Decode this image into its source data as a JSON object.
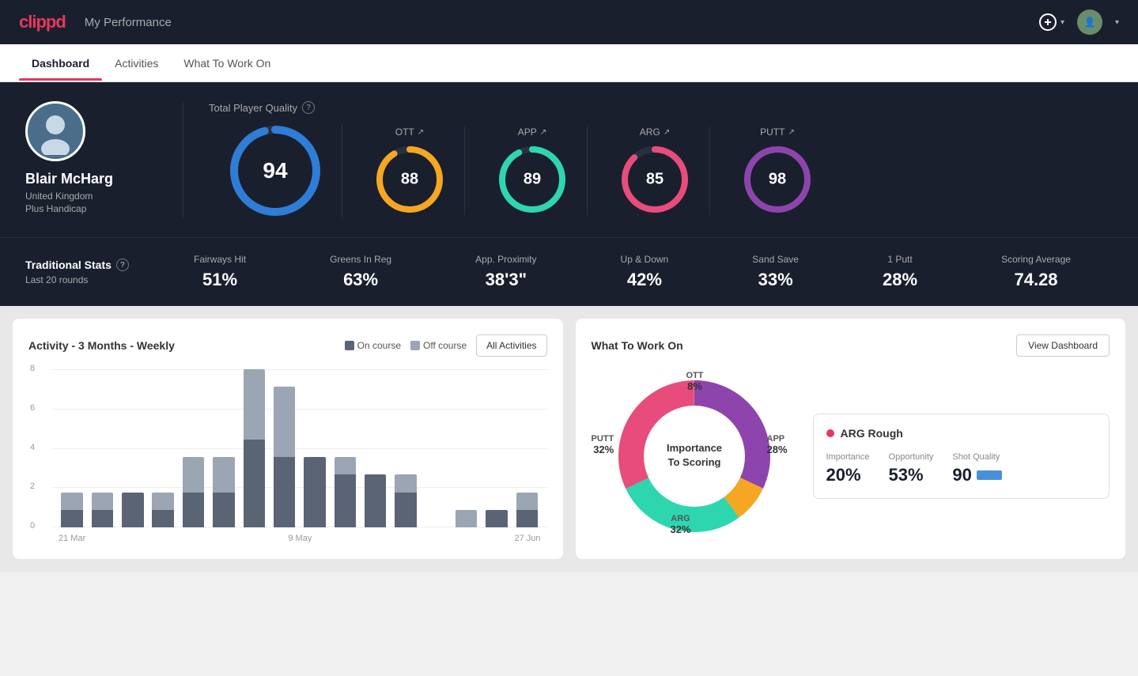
{
  "app": {
    "logo": "clippd",
    "header_title": "My Performance"
  },
  "tabs": [
    {
      "label": "Dashboard",
      "active": true
    },
    {
      "label": "Activities",
      "active": false
    },
    {
      "label": "What To Work On",
      "active": false
    }
  ],
  "profile": {
    "name": "Blair McHarg",
    "country": "United Kingdom",
    "handicap": "Plus Handicap",
    "avatar_emoji": "🧍"
  },
  "scores": {
    "title": "Total Player Quality",
    "main": {
      "value": "94",
      "color": "#2e7dd6"
    },
    "items": [
      {
        "label": "OTT",
        "value": "88",
        "color": "#f5a623"
      },
      {
        "label": "APP",
        "value": "89",
        "color": "#2ed6b0"
      },
      {
        "label": "ARG",
        "value": "85",
        "color": "#e84c7a"
      },
      {
        "label": "PUTT",
        "value": "98",
        "color": "#8e44ad"
      }
    ]
  },
  "trad_stats": {
    "title": "Traditional Stats",
    "subtitle": "Last 20 rounds",
    "items": [
      {
        "label": "Fairways Hit",
        "value": "51%"
      },
      {
        "label": "Greens In Reg",
        "value": "63%"
      },
      {
        "label": "App. Proximity",
        "value": "38'3\""
      },
      {
        "label": "Up & Down",
        "value": "42%"
      },
      {
        "label": "Sand Save",
        "value": "33%"
      },
      {
        "label": "1 Putt",
        "value": "28%"
      },
      {
        "label": "Scoring Average",
        "value": "74.28"
      }
    ]
  },
  "activity": {
    "title": "Activity - 3 Months - Weekly",
    "legend_on": "On course",
    "legend_off": "Off course",
    "all_btn": "All Activities",
    "y_labels": [
      "8",
      "6",
      "4",
      "2",
      "0"
    ],
    "x_labels": [
      "21 Mar",
      "9 May",
      "27 Jun"
    ],
    "bars": [
      {
        "on": 1,
        "off": 1
      },
      {
        "on": 1,
        "off": 1
      },
      {
        "on": 2,
        "off": 0
      },
      {
        "on": 1,
        "off": 1
      },
      {
        "on": 2,
        "off": 2
      },
      {
        "on": 2,
        "off": 2
      },
      {
        "on": 5,
        "off": 4
      },
      {
        "on": 4,
        "off": 4
      },
      {
        "on": 4,
        "off": 0
      },
      {
        "on": 3,
        "off": 1
      },
      {
        "on": 3,
        "off": 0
      },
      {
        "on": 2,
        "off": 1
      },
      {
        "on": 0,
        "off": 0
      },
      {
        "on": 0,
        "off": 1
      },
      {
        "on": 1,
        "off": 0
      },
      {
        "on": 1,
        "off": 1
      }
    ]
  },
  "work_on": {
    "title": "What To Work On",
    "view_btn": "View Dashboard",
    "donut_center": "Importance\nTo Scoring",
    "segments": [
      {
        "label": "OTT",
        "pct": "8%",
        "color": "#f5a623"
      },
      {
        "label": "APP",
        "pct": "28%",
        "color": "#2ed6b0"
      },
      {
        "label": "ARG",
        "pct": "32%",
        "color": "#e84c7a"
      },
      {
        "label": "PUTT",
        "pct": "32%",
        "color": "#8e44ad"
      }
    ],
    "highlight": {
      "title": "ARG Rough",
      "metrics": [
        {
          "label": "Importance",
          "value": "20%"
        },
        {
          "label": "Opportunity",
          "value": "53%"
        },
        {
          "label": "Shot Quality",
          "value": "90"
        }
      ]
    }
  }
}
